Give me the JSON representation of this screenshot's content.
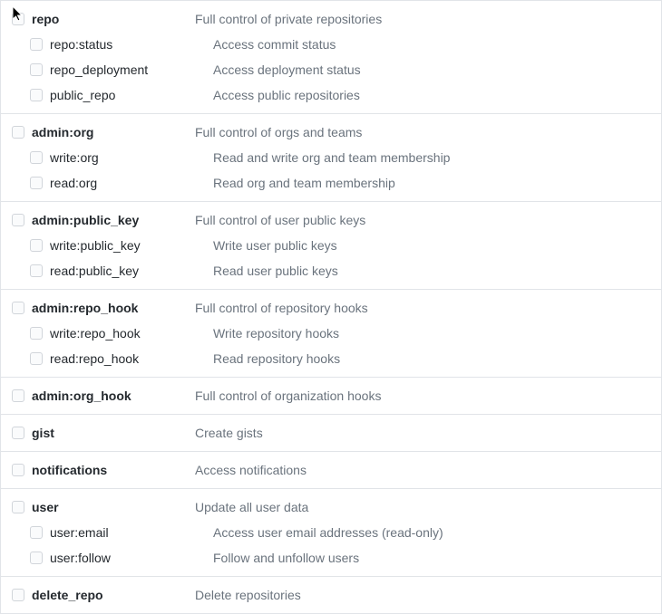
{
  "scopes": [
    {
      "key": "repo",
      "label": "repo",
      "desc": "Full control of private repositories",
      "children": [
        {
          "key": "repo-status",
          "label": "repo:status",
          "desc": "Access commit status"
        },
        {
          "key": "repo-deployment",
          "label": "repo_deployment",
          "desc": "Access deployment status"
        },
        {
          "key": "public-repo",
          "label": "public_repo",
          "desc": "Access public repositories"
        }
      ]
    },
    {
      "key": "admin-org",
      "label": "admin:org",
      "desc": "Full control of orgs and teams",
      "children": [
        {
          "key": "write-org",
          "label": "write:org",
          "desc": "Read and write org and team membership"
        },
        {
          "key": "read-org",
          "label": "read:org",
          "desc": "Read org and team membership"
        }
      ]
    },
    {
      "key": "admin-public-key",
      "label": "admin:public_key",
      "desc": "Full control of user public keys",
      "children": [
        {
          "key": "write-public-key",
          "label": "write:public_key",
          "desc": "Write user public keys"
        },
        {
          "key": "read-public-key",
          "label": "read:public_key",
          "desc": "Read user public keys"
        }
      ]
    },
    {
      "key": "admin-repo-hook",
      "label": "admin:repo_hook",
      "desc": "Full control of repository hooks",
      "children": [
        {
          "key": "write-repo-hook",
          "label": "write:repo_hook",
          "desc": "Write repository hooks"
        },
        {
          "key": "read-repo-hook",
          "label": "read:repo_hook",
          "desc": "Read repository hooks"
        }
      ]
    },
    {
      "key": "admin-org-hook",
      "label": "admin:org_hook",
      "desc": "Full control of organization hooks",
      "children": []
    },
    {
      "key": "gist",
      "label": "gist",
      "desc": "Create gists",
      "children": []
    },
    {
      "key": "notifications",
      "label": "notifications",
      "desc": "Access notifications",
      "children": []
    },
    {
      "key": "user",
      "label": "user",
      "desc": "Update all user data",
      "children": [
        {
          "key": "user-email",
          "label": "user:email",
          "desc": "Access user email addresses (read-only)"
        },
        {
          "key": "user-follow",
          "label": "user:follow",
          "desc": "Follow and unfollow users"
        }
      ]
    },
    {
      "key": "delete-repo",
      "label": "delete_repo",
      "desc": "Delete repositories",
      "children": []
    }
  ]
}
